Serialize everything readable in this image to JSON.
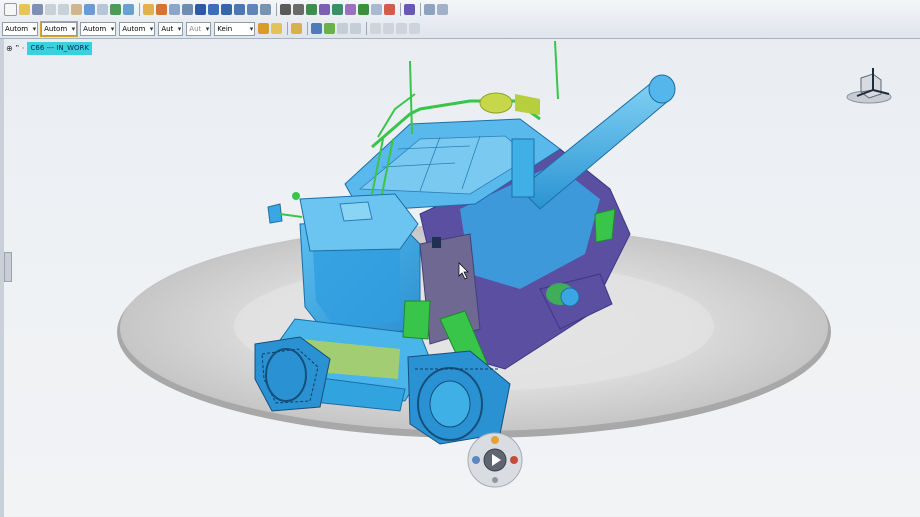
{
  "toolbar": {
    "row1_icons": [
      "new-icon",
      "open-icon",
      "save-icon",
      "cut-icon",
      "copy-icon",
      "paste-icon",
      "undo-icon",
      "redo-icon",
      "assembly-icon",
      "fit-all-icon",
      "render-icon",
      "view-icon",
      "zoom-icon",
      "pan-icon",
      "rotate-icon",
      "search-icon",
      "measure-icon",
      "section-icon",
      "material-icon",
      "light-icon",
      "camera-icon",
      "export-icon",
      "select-icon"
    ],
    "dropdowns": [
      {
        "label": "Autom",
        "disabled": false
      },
      {
        "label": "Autom",
        "disabled": false
      },
      {
        "label": "Autom",
        "disabled": false
      },
      {
        "label": "Autom",
        "disabled": false
      },
      {
        "label": "Aut",
        "disabled": false
      },
      {
        "label": "Aut",
        "disabled": true
      },
      {
        "label": "Kein",
        "disabled": false
      }
    ]
  },
  "tree": {
    "expander": "⊕ ‟ ·",
    "root_label": "C66 --- IN_WORK"
  },
  "colors": {
    "model_cyan": "#2fa9e6",
    "model_purple": "#5a4fa0",
    "model_green": "#39c44a",
    "model_yellow": "#c7d74a",
    "turntable": "#c9c9c9",
    "selection_cyan": "#3ad0e0"
  },
  "icons": {
    "compass": "view-compass-icon",
    "dial": "playback-dial-icon",
    "cursor": "mouse-pointer-icon"
  }
}
